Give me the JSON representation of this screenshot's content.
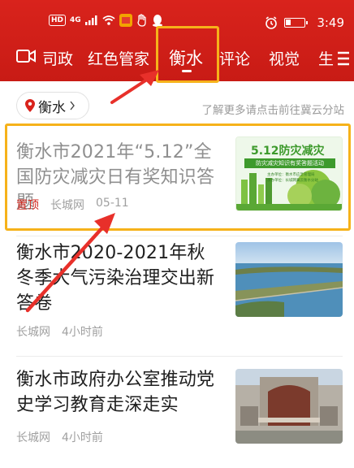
{
  "status": {
    "hd": "HD",
    "signal": "4G",
    "time": "3:49"
  },
  "nav": {
    "tabs": [
      {
        "label": "司政"
      },
      {
        "label": "红色管家"
      },
      {
        "label": "衡水"
      },
      {
        "label": "评论"
      },
      {
        "label": "视觉"
      },
      {
        "label": "生"
      }
    ],
    "active_index": 2
  },
  "location": {
    "city": "衡水",
    "link": "了解更多请点击前往冀云分站"
  },
  "articles": [
    {
      "title": "衡水市2021年“5.12”全国防灾减灾日有奖知识答题",
      "pinned": "置顶",
      "source": "长城网",
      "time": "05-11",
      "thumb": {
        "heading": "5.12防灾减灾",
        "banner": "防灾减灾知识有奖答题活动",
        "line1": "主办单位：衡水市应急管理局",
        "line2": "承办单位：长城网冀云衡水分站"
      }
    },
    {
      "title": "衡水市2020-2021年秋冬季大气污染治理交出新答卷",
      "source": "长城网",
      "time": "4小时前"
    },
    {
      "title": "衡水市政府办公室推动党史学习教育走深走实",
      "source": "长城网",
      "time": "4小时前"
    }
  ],
  "colors": {
    "brand_red": "#d9231c",
    "highlight": "#f6b21a",
    "arrow": "#e8302a"
  }
}
